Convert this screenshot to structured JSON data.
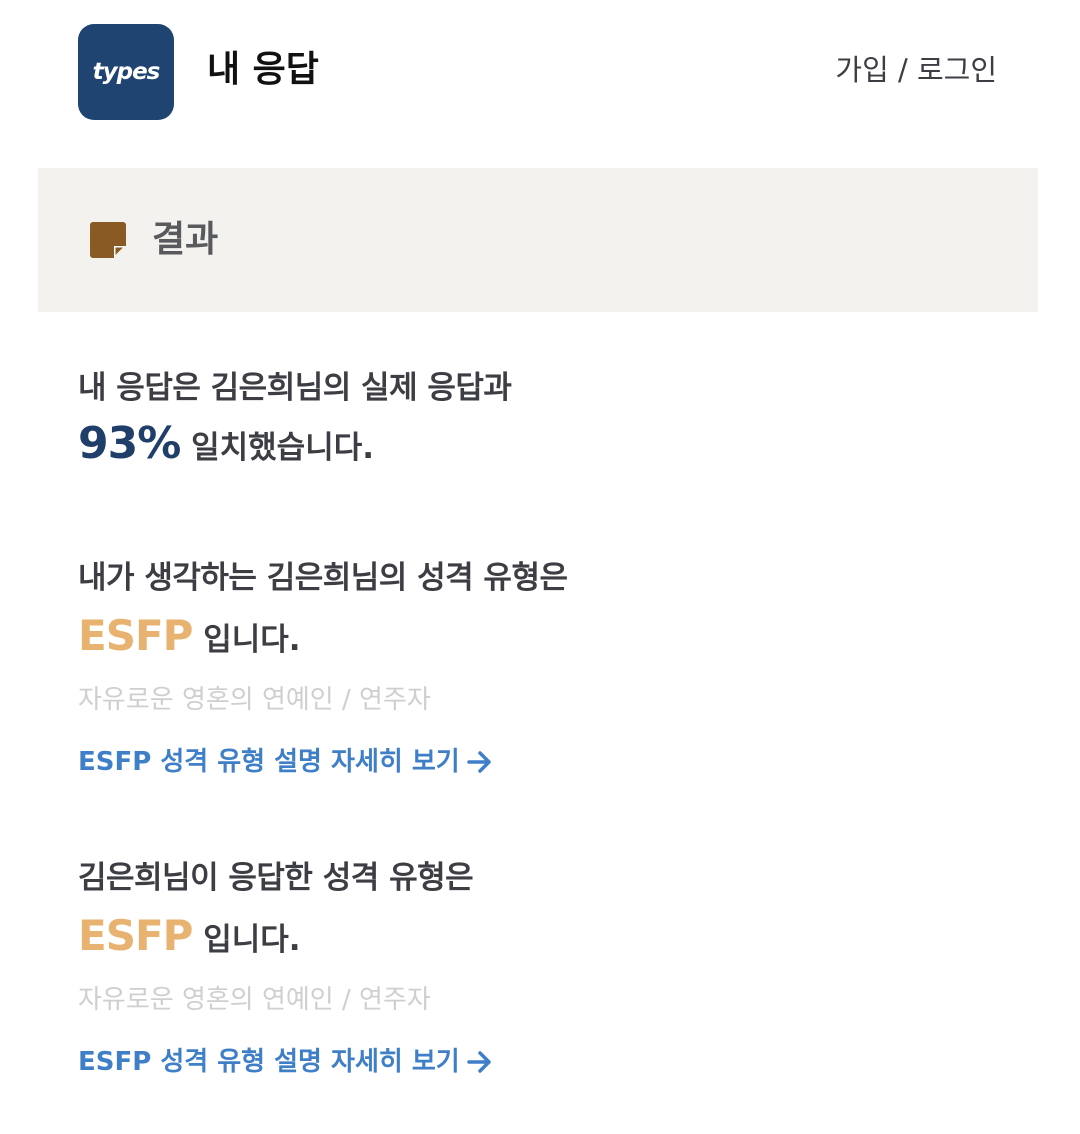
{
  "header": {
    "logo_text": "types",
    "title": "내 응답",
    "auth_link": "가입 / 로그인"
  },
  "section": {
    "title": "결과",
    "icon": "memo-icon"
  },
  "match": {
    "line1": "내 응답은 김은희님의 실제 응답과",
    "percent": "93%",
    "line2_suffix": "일치했습니다."
  },
  "my_guess": {
    "heading": "내가 생각하는 김은희님의 성격 유형은",
    "type": "ESFP",
    "type_suffix": "입니다.",
    "nickname": "자유로운 영혼의 연예인 / 연주자",
    "link_label": "ESFP 성격 유형 설명 자세히 보기"
  },
  "actual": {
    "heading": "김은희님이 응답한 성격 유형은",
    "type": "ESFP",
    "type_suffix": "입니다.",
    "nickname": "자유로운 영혼의 연예인 / 연주자",
    "link_label": "ESFP 성격 유형 설명 자세히 보기"
  },
  "colors": {
    "brand": "#1f4472",
    "percent": "#1f3f6a",
    "type_accent": "#e8b370",
    "link": "#3f7fc7",
    "section_bg": "#f3f2ef",
    "icon": "#8a5a24"
  }
}
